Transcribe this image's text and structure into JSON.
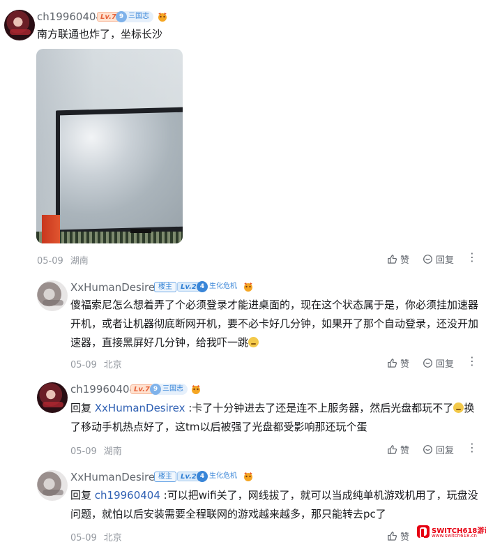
{
  "comment_main": {
    "username": "ch19960404",
    "level": "Lv.7",
    "fan_level": "9",
    "fan_name": "三国志",
    "text": "南方联通也炸了，坐标长沙",
    "date": "05-09",
    "location": "湖南",
    "like_label": "赞",
    "reply_label": "回复"
  },
  "reply_1": {
    "username": "XxHumanDesirex",
    "owner_badge": "楼主",
    "level": "Lv.2",
    "fan_level": "4",
    "fan_name": "生化危机",
    "text": "傻福索尼怎么想着弄了个必须登录才能进桌面的，现在这个状态属于是，你必须挂加速器开机，或者让机器彻底断网开机，要不必卡好几分钟，如果开了那个自动登录，还没开加速器，直接黑屏好几分钟，给我吓一跳",
    "date": "05-09",
    "location": "北京",
    "like_label": "赞",
    "reply_label": "回复"
  },
  "reply_2": {
    "username": "ch19960404",
    "level": "Lv.7",
    "fan_level": "9",
    "fan_name": "三国志",
    "reply_prefix": "回复 ",
    "mention": "XxHumanDesirex",
    "text_before_emoji": " :卡了十分钟进去了还是连不上服务器，然后光盘都玩不了",
    "text_after_emoji": "换了移动手机热点好了，这tm以后被强了光盘都受影响那还玩个蛋",
    "date": "05-09",
    "location": "湖南",
    "like_label": "赞",
    "reply_label": "回复"
  },
  "reply_3": {
    "username": "XxHumanDesirex",
    "owner_badge": "楼主",
    "level": "Lv.2",
    "fan_level": "4",
    "fan_name": "生化危机",
    "reply_prefix": "回复 ",
    "mention": "ch19960404",
    "text": " :可以把wifi关了，网线拔了，就可以当成纯单机游戏机用了，玩盘没问题，就怕以后安装需要全程联网的游戏越来越多，那只能转去pc了",
    "date": "05-09",
    "location": "北京",
    "like_label": "赞"
  },
  "watermark": {
    "brand": "SWITCH618游讯",
    "sub": "www.switch618.cn"
  },
  "icons": {
    "like": "thumbs-up-icon",
    "reply": "reply-bubble-icon",
    "more": "more-dots-icon",
    "medal": "fan-medal-icon"
  },
  "colors": {
    "username": "#61666d",
    "mention": "#2f60b3",
    "meta": "#9499a0",
    "level_high": "#e6623a",
    "level_low": "#2f7fd3"
  }
}
